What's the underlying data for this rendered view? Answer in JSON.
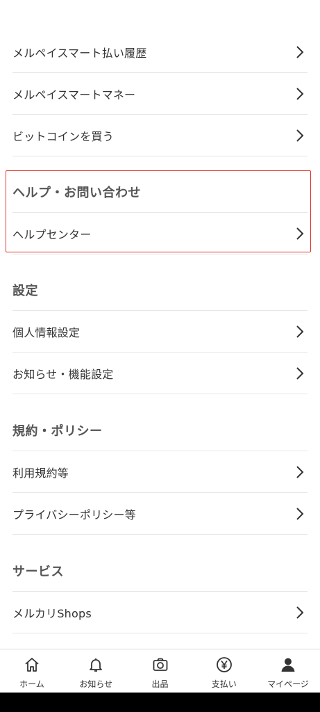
{
  "menu": {
    "rows_top": [
      {
        "label": "メルペイスマート払い履歴"
      },
      {
        "label": "メルペイスマートマネー"
      },
      {
        "label": "ビットコインを買う"
      }
    ],
    "help": {
      "header": "ヘルプ・お問い合わせ",
      "items": [
        {
          "label": "ヘルプセンター"
        }
      ]
    },
    "settings": {
      "header": "設定",
      "items": [
        {
          "label": "個人情報設定"
        },
        {
          "label": "お知らせ・機能設定"
        }
      ]
    },
    "policy": {
      "header": "規約・ポリシー",
      "items": [
        {
          "label": "利用規約等"
        },
        {
          "label": "プライバシーポリシー等"
        }
      ]
    },
    "services": {
      "header": "サービス",
      "items": [
        {
          "label": "メルカリShops"
        }
      ]
    }
  },
  "tabbar": {
    "items": [
      {
        "label": "ホーム",
        "icon": "home-icon"
      },
      {
        "label": "お知らせ",
        "icon": "bell-icon"
      },
      {
        "label": "出品",
        "icon": "camera-icon"
      },
      {
        "label": "支払い",
        "icon": "yen-icon"
      },
      {
        "label": "マイページ",
        "icon": "person-icon"
      }
    ]
  },
  "colors": {
    "highlight_border": "#e0352b",
    "text": "#333333",
    "divider": "#e6e6e6"
  }
}
